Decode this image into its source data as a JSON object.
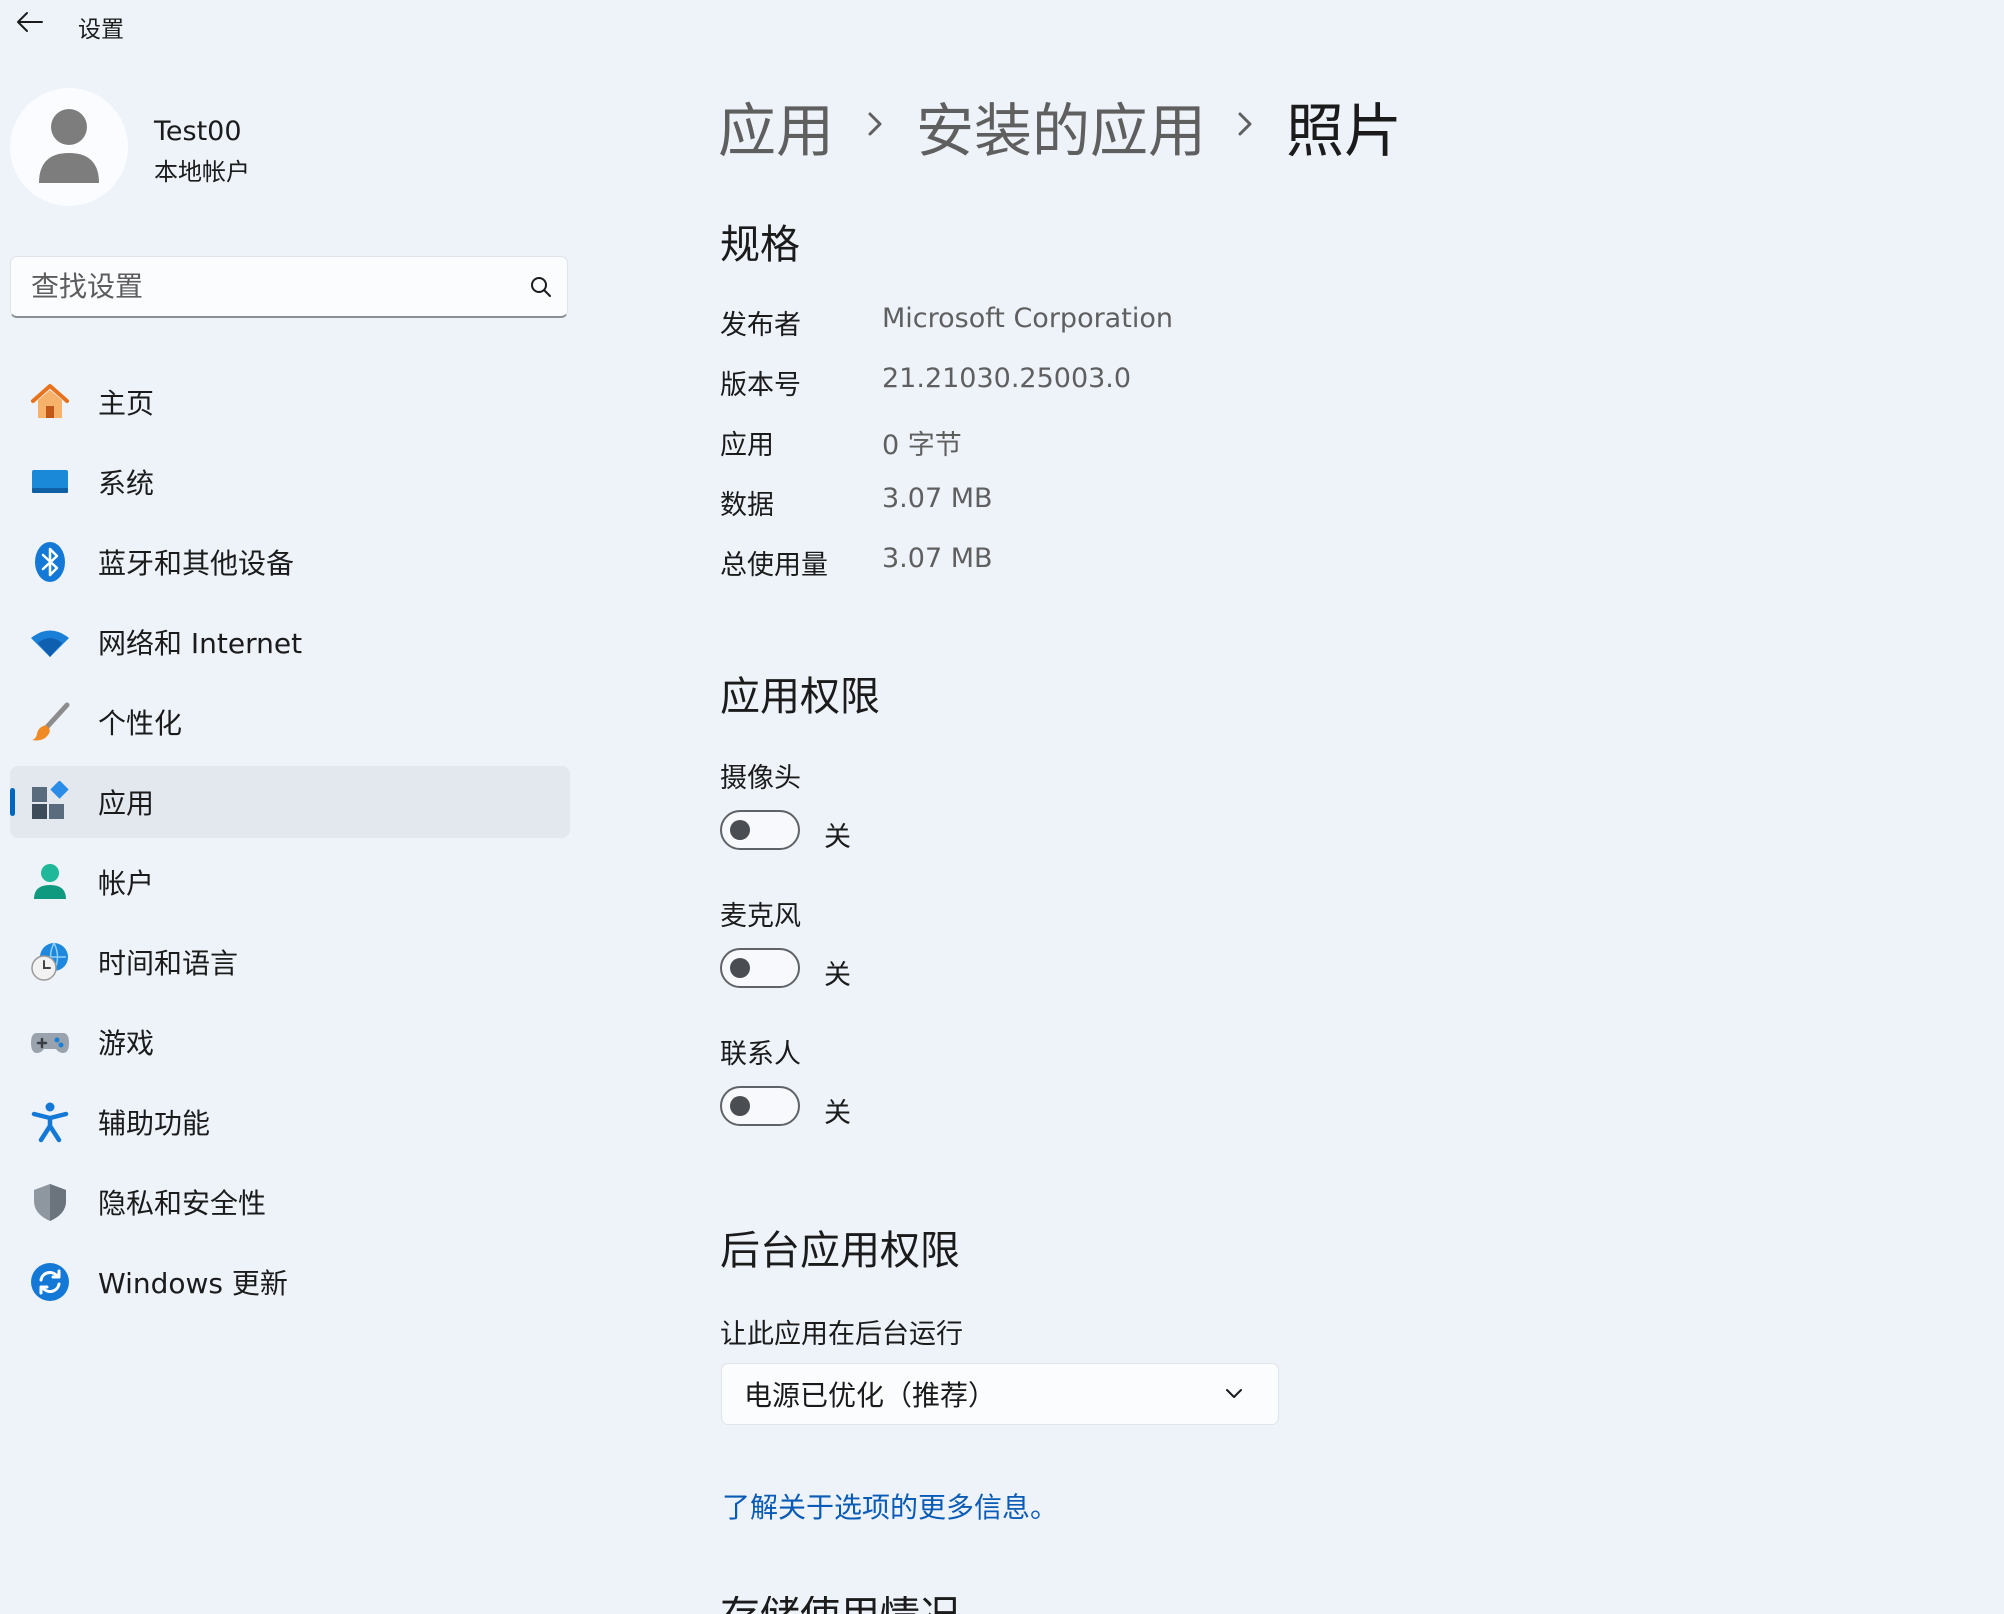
{
  "window": {
    "title": "设置"
  },
  "user": {
    "name": "Test00",
    "account_type": "本地帐户"
  },
  "search": {
    "placeholder": "查找设置"
  },
  "nav": {
    "items": [
      {
        "label": "主页",
        "icon": "home-icon"
      },
      {
        "label": "系统",
        "icon": "system-icon"
      },
      {
        "label": "蓝牙和其他设备",
        "icon": "bluetooth-icon"
      },
      {
        "label": "网络和 Internet",
        "icon": "wifi-icon"
      },
      {
        "label": "个性化",
        "icon": "brush-icon"
      },
      {
        "label": "应用",
        "icon": "apps-icon",
        "selected": true
      },
      {
        "label": "帐户",
        "icon": "account-icon"
      },
      {
        "label": "时间和语言",
        "icon": "time-language-icon"
      },
      {
        "label": "游戏",
        "icon": "gamepad-icon"
      },
      {
        "label": "辅助功能",
        "icon": "accessibility-icon"
      },
      {
        "label": "隐私和安全性",
        "icon": "shield-icon"
      },
      {
        "label": "Windows 更新",
        "icon": "update-icon"
      }
    ]
  },
  "breadcrumb": {
    "level1": "应用",
    "level2": "安装的应用",
    "current": "照片"
  },
  "specs": {
    "title": "规格",
    "rows": [
      {
        "label": "发布者",
        "value": "Microsoft Corporation"
      },
      {
        "label": "版本号",
        "value": "21.21030.25003.0"
      },
      {
        "label": "应用",
        "value": "0 字节"
      },
      {
        "label": "数据",
        "value": "3.07 MB"
      },
      {
        "label": "总使用量",
        "value": "3.07 MB"
      }
    ]
  },
  "permissions": {
    "title": "应用权限",
    "items": [
      {
        "label": "摄像头",
        "state": "关"
      },
      {
        "label": "麦克风",
        "state": "关"
      },
      {
        "label": "联系人",
        "state": "关"
      }
    ]
  },
  "background": {
    "title": "后台应用权限",
    "setting_label": "让此应用在后台运行",
    "selected_option": "电源已优化（推荐）",
    "learn_more": "了解关于选项的更多信息。"
  },
  "next_section": {
    "title": "存储使用情况"
  },
  "colors": {
    "accent": "#0067c0",
    "link": "#0a5bb5",
    "background": "#eef3fa"
  }
}
